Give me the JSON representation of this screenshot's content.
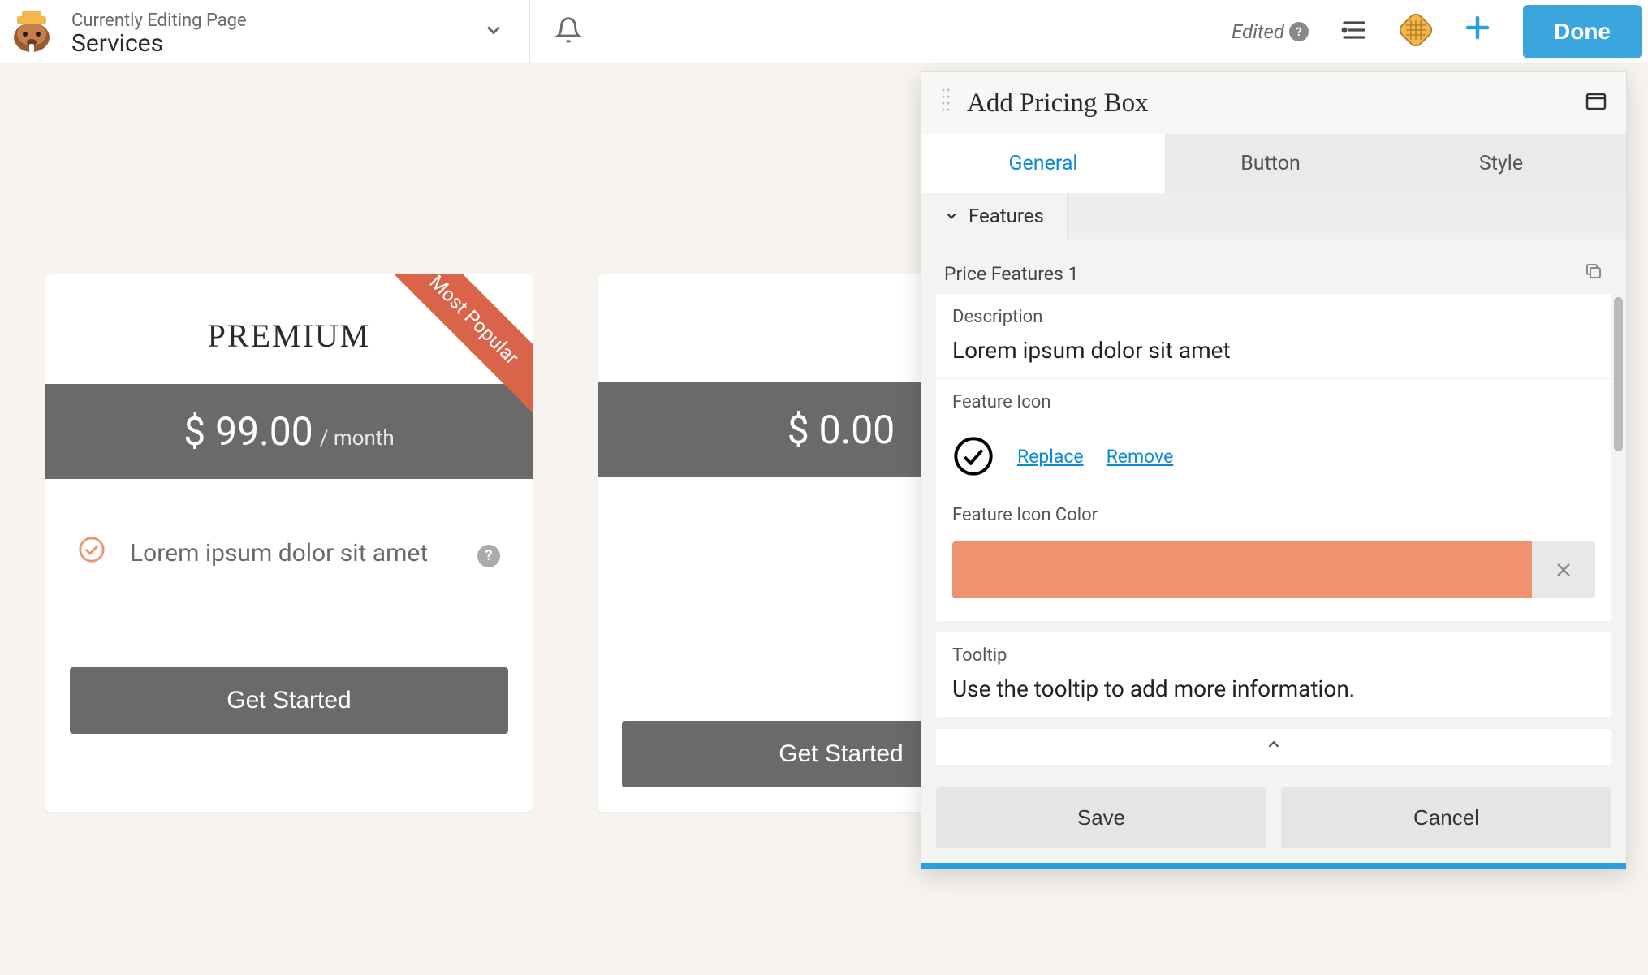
{
  "topbar": {
    "editing_label": "Currently Editing Page",
    "page_title": "Services",
    "edited_label": "Edited",
    "done_label": "Done"
  },
  "canvas": {
    "cards": [
      {
        "title": "PREMIUM",
        "ribbon": "Most Popular",
        "price": "$ 99.00",
        "duration": "/ month",
        "feature_text": "Lorem ipsum dolor sit amet",
        "button_label": "Get Started"
      },
      {
        "title": "",
        "price": "$ 0.00",
        "button_label": "Get Started"
      }
    ]
  },
  "panel": {
    "title": "Add Pricing Box",
    "tabs": {
      "general": "General",
      "button": "Button",
      "style": "Style"
    },
    "subtab": "Features",
    "section_title": "Price Features 1",
    "fields": {
      "description_label": "Description",
      "description_value": "Lorem ipsum dolor sit amet",
      "feature_icon_label": "Feature Icon",
      "replace": "Replace",
      "remove": "Remove",
      "feature_icon_color_label": "Feature Icon Color",
      "feature_icon_color": "#ee9270",
      "tooltip_label": "Tooltip",
      "tooltip_value": "Use the tooltip to add more information."
    },
    "save_label": "Save",
    "cancel_label": "Cancel"
  }
}
